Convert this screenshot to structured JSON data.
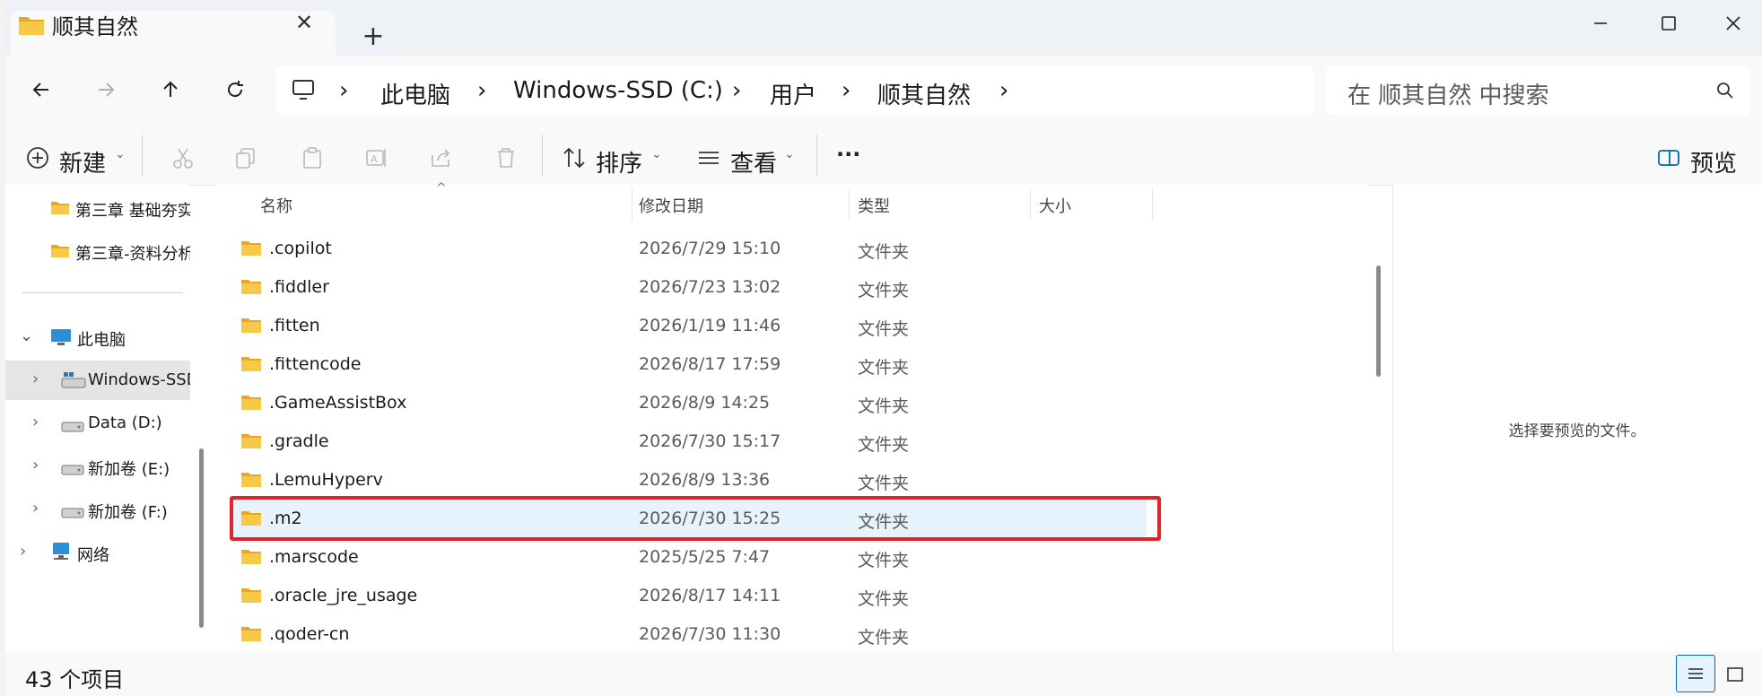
{
  "tab": {
    "title": "顺其自然",
    "new_tab": "+",
    "close": "✕"
  },
  "nav": {
    "breadcrumb": [
      "此电脑",
      "Windows-SSD (C:)",
      "用户",
      "顺其自然"
    ],
    "search_placeholder": "在 顺其自然 中搜索"
  },
  "command_bar": {
    "new_label": "新建",
    "sort_label": "排序",
    "view_label": "查看",
    "more_label": "···",
    "preview_label": "预览"
  },
  "sidebar": {
    "items": [
      {
        "label": "第三章 基础夯实",
        "icon": "folder-icon"
      },
      {
        "label": "第三章-资料分析",
        "icon": "folder-icon"
      },
      {
        "label": "此电脑",
        "icon": "computer-icon",
        "expanded": true
      },
      {
        "label": "Windows-SSD (C:)",
        "icon": "drive-windows-icon",
        "selected": true
      },
      {
        "label": "Data (D:)",
        "icon": "drive-icon"
      },
      {
        "label": "新加卷 (E:)",
        "icon": "drive-icon"
      },
      {
        "label": "新加卷 (F:)",
        "icon": "drive-icon"
      },
      {
        "label": "网络",
        "icon": "network-icon"
      }
    ]
  },
  "columns": {
    "name": "名称",
    "date": "修改日期",
    "type": "类型",
    "size": "大小"
  },
  "files": [
    {
      "name": ".copilot",
      "date": "2026/7/29 15:10",
      "type": "文件夹"
    },
    {
      "name": ".fiddler",
      "date": "2026/7/23 13:02",
      "type": "文件夹"
    },
    {
      "name": ".fitten",
      "date": "2026/1/19 11:46",
      "type": "文件夹"
    },
    {
      "name": ".fittencode",
      "date": "2026/8/17 17:59",
      "type": "文件夹"
    },
    {
      "name": ".GameAssistBox",
      "date": "2026/8/9 14:25",
      "type": "文件夹"
    },
    {
      "name": ".gradle",
      "date": "2026/7/30 15:17",
      "type": "文件夹"
    },
    {
      "name": ".LemuHyperv",
      "date": "2026/8/9 13:36",
      "type": "文件夹"
    },
    {
      "name": ".m2",
      "date": "2026/7/30 15:25",
      "type": "文件夹",
      "selected": true
    },
    {
      "name": ".marscode",
      "date": "2025/5/25 7:47",
      "type": "文件夹"
    },
    {
      "name": ".oracle_jre_usage",
      "date": "2026/8/17 14:11",
      "type": "文件夹"
    },
    {
      "name": ".qoder-cn",
      "date": "2026/7/30 11:30",
      "type": "文件夹"
    }
  ],
  "preview": {
    "empty_text": "选择要预览的文件。"
  },
  "status": {
    "count": "43 个项目"
  },
  "colors": {
    "accent": "#0067c0",
    "folder": "#f4c542",
    "selection": "#e6f2fc",
    "highlight_box": "#e0242c"
  }
}
